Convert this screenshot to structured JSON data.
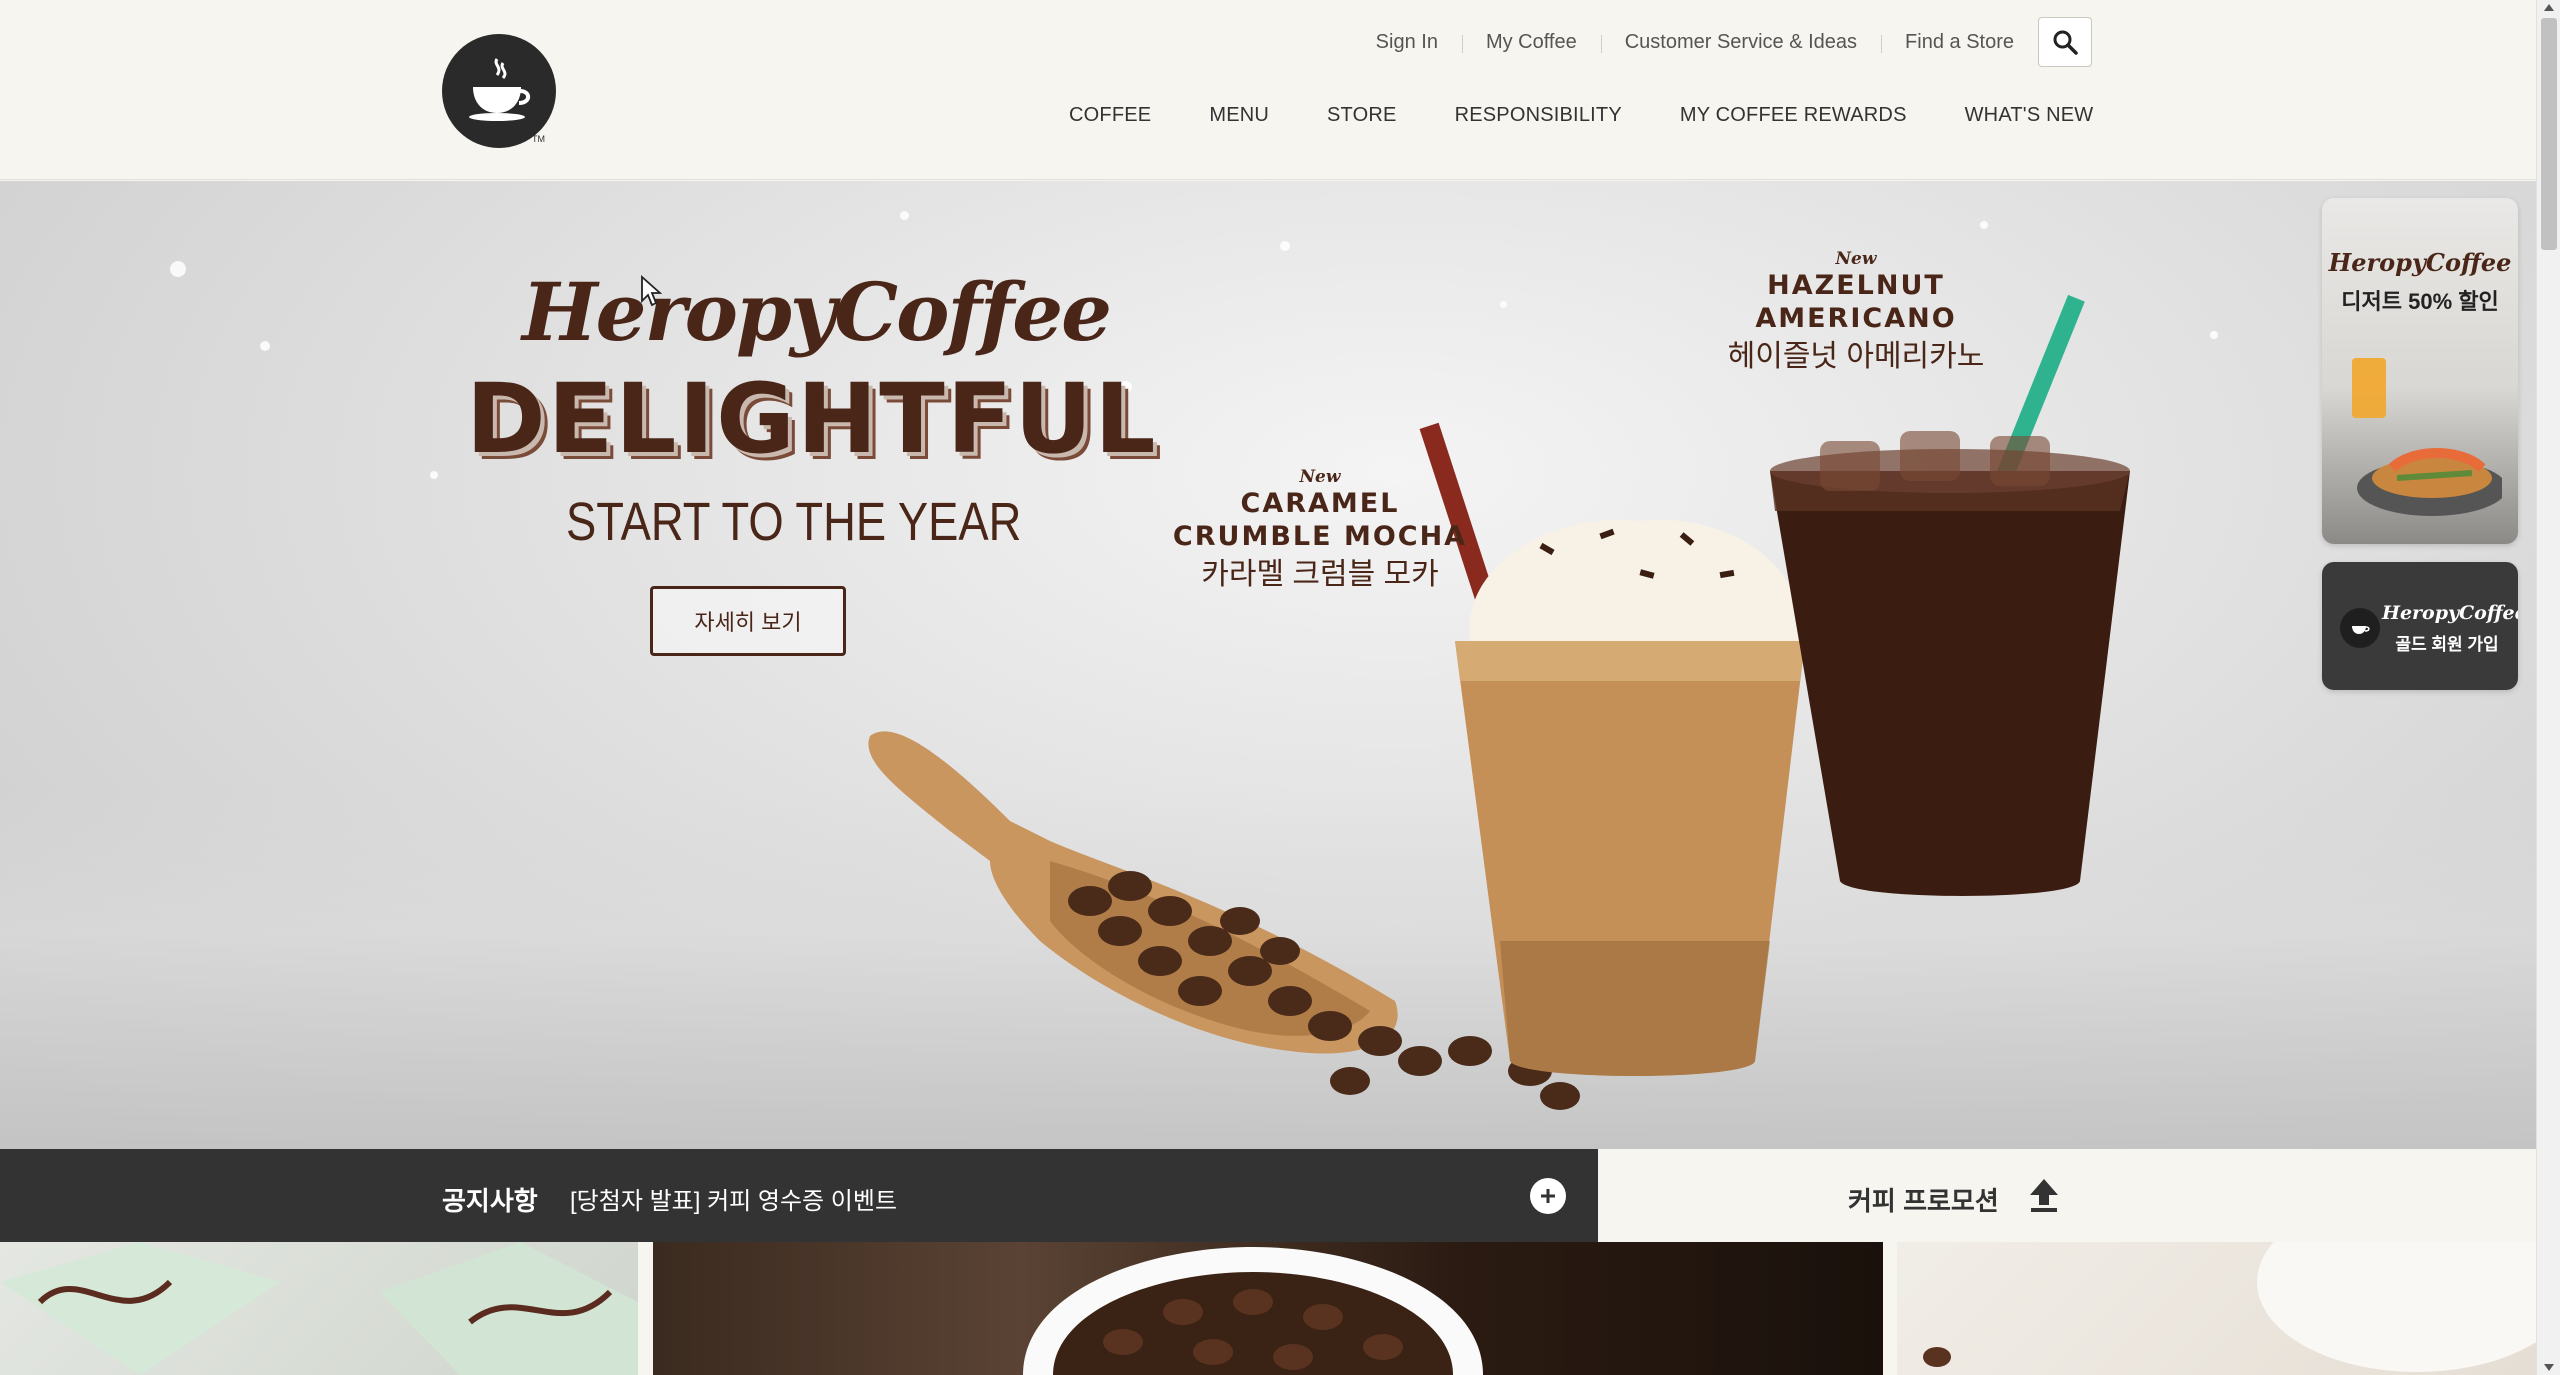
{
  "header": {
    "sub_menu": [
      "Sign In",
      "My Coffee",
      "Customer Service & Ideas",
      "Find a Store"
    ],
    "main_menu": [
      "COFFEE",
      "MENU",
      "STORE",
      "RESPONSIBILITY",
      "MY COFFEE REWARDS",
      "WHAT'S NEW"
    ],
    "logo_tm": "TM"
  },
  "hero": {
    "brand": "HeropyCoffee",
    "headline": "DELIGHTFUL",
    "subline": "START TO THE YEAR",
    "button": "자세히 보기",
    "products": [
      {
        "new": "New",
        "en_line1": "CARAMEL",
        "en_line2": "CRUMBLE MOCHA",
        "ko": "카라멜 크럼블 모카"
      },
      {
        "new": "New",
        "en_line1": "HAZELNUT",
        "en_line2": "AMERICANO",
        "ko": "헤이즐넛 아메리카노"
      }
    ]
  },
  "side_banners": [
    {
      "brand": "HeropyCoffee",
      "text": "디저트 50% 할인"
    },
    {
      "brand": "HeropyCoffee",
      "text": "골드 회원 가입"
    }
  ],
  "notice": {
    "title": "공지사항",
    "text": "[당첨자 발표] 커피 영수증 이벤트"
  },
  "promotion": {
    "label": "커피 프로모션"
  },
  "colors": {
    "brand_brown": "#4a2618",
    "notice_bg": "#333333",
    "header_bg": "#f6f5ef"
  }
}
